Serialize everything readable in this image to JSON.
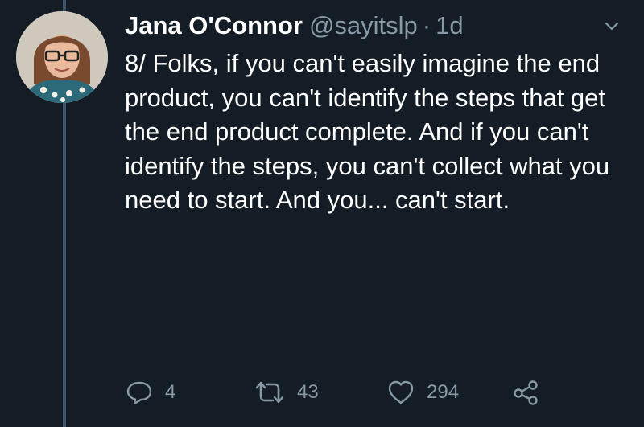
{
  "tweet": {
    "display_name": "Jana O'Connor",
    "handle": "@sayitslp",
    "separator": "·",
    "time": "1d",
    "text": "8/ Folks, if you can't easily imagine the end product, you can't identify the steps that get the end product complete. And if you can't identify the steps, you can't collect what you need to start. And you... can't start."
  },
  "actions": {
    "reply_count": "4",
    "retweet_count": "43",
    "like_count": "294"
  },
  "icons": {
    "reply": "reply-icon",
    "retweet": "retweet-icon",
    "like": "heart-icon",
    "share": "share-icon",
    "menu": "chevron-down-icon"
  },
  "colors": {
    "background": "#141d26",
    "text": "#ffffff",
    "secondary": "#8899a6",
    "thread_line": "#3d5466"
  }
}
